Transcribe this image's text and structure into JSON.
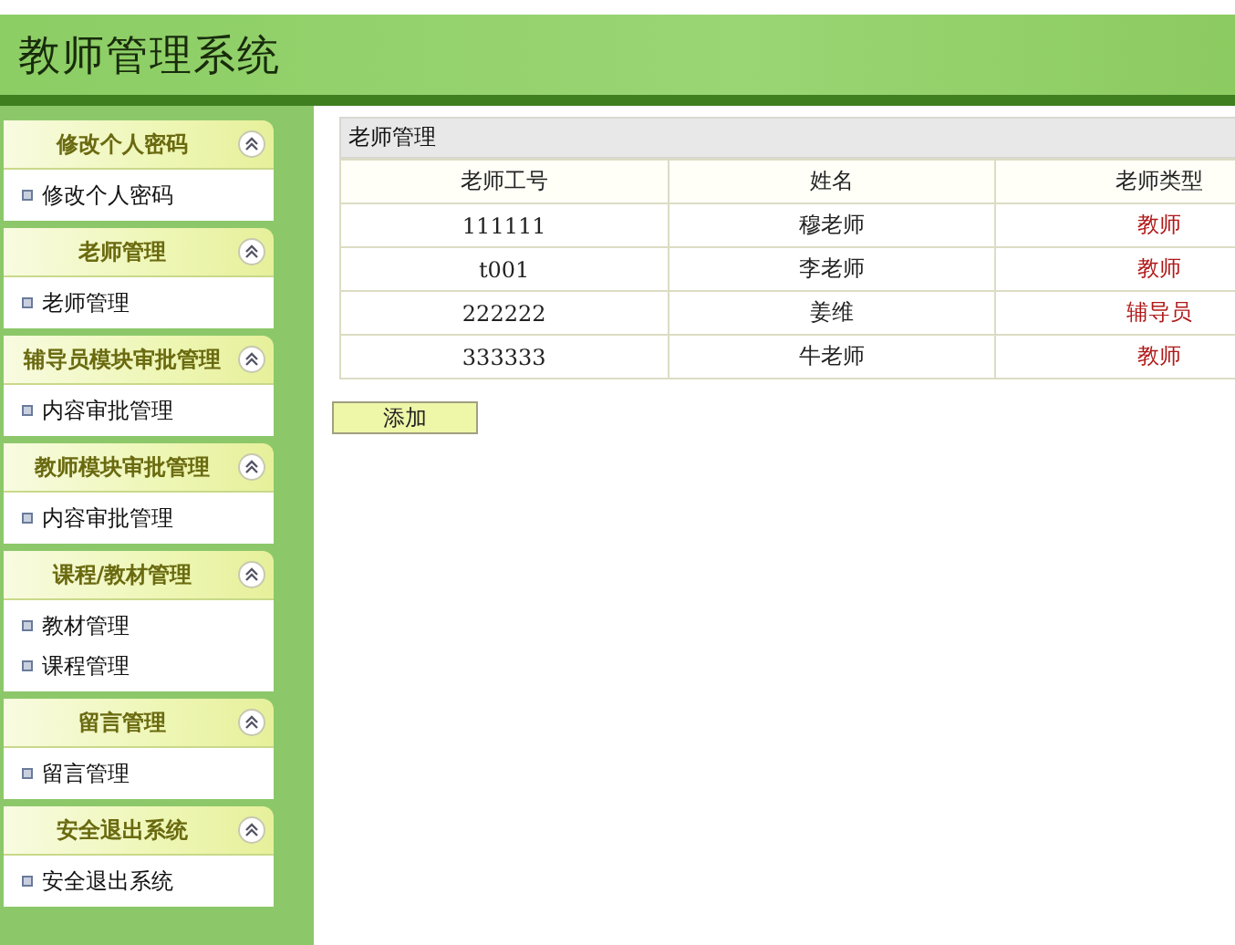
{
  "header": {
    "title": "教师管理系统"
  },
  "sidebar": {
    "groups": [
      {
        "title": "修改个人密码",
        "expanded": true,
        "items": [
          "修改个人密码"
        ]
      },
      {
        "title": "老师管理",
        "expanded": true,
        "items": [
          "老师管理"
        ]
      },
      {
        "title": "辅导员模块审批管理",
        "expanded": true,
        "items": [
          "内容审批管理"
        ]
      },
      {
        "title": "教师模块审批管理",
        "expanded": true,
        "items": [
          "内容审批管理"
        ]
      },
      {
        "title": "课程/教材管理",
        "expanded": true,
        "items": [
          "教材管理",
          "课程管理"
        ]
      },
      {
        "title": "留言管理",
        "expanded": true,
        "items": [
          "留言管理"
        ]
      },
      {
        "title": "安全退出系统",
        "expanded": true,
        "items": [
          "安全退出系统"
        ]
      }
    ]
  },
  "table": {
    "title": "老师管理",
    "columns": [
      "老师工号",
      "姓名",
      "老师类型"
    ],
    "rows": [
      [
        "111111",
        "穆老师",
        "教师"
      ],
      [
        "t001",
        "李老师",
        "教师"
      ],
      [
        "222222",
        "姜维",
        "辅导员"
      ],
      [
        "333333",
        "牛老师",
        "教师"
      ]
    ]
  },
  "buttons": [
    "添加"
  ]
}
